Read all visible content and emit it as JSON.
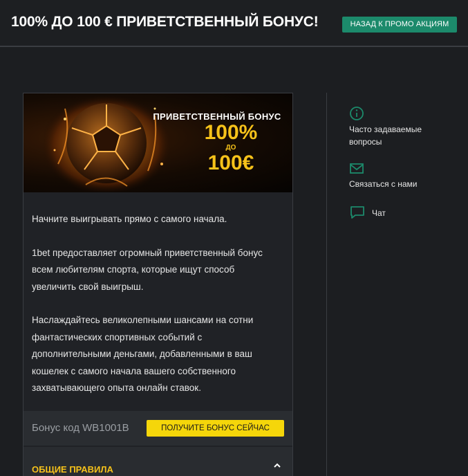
{
  "header": {
    "title": "100% ДО 100 € ПРИВЕТСТВЕННЫЙ БОНУС!",
    "back_button": "НАЗАД К ПРОМО АКЦИЯМ"
  },
  "banner": {
    "line1": "ПРИВЕТСТВЕННЫЙ БОНУС",
    "percent": "100%",
    "do": "ДО",
    "amount": "100€"
  },
  "body": {
    "p1": "Начните выигрывать прямо с самого начала.",
    "p2": "1bet предоставляет огромный приветственный бонус всем любителям спорта, которые ищут способ увеличить свой выигрыш.",
    "p3": "Наслаждайтесь великолепными шансами на сотни фантастических спортивных событий с дополнительными деньгами, добавленными в ваш кошелек с самого начала вашего собственного захватывающего опыта онлайн ставок."
  },
  "bonus": {
    "code_label": "Бонус код WB1001B",
    "get_button": "ПОЛУЧИТЕ БОНУС СЕЙЧАС"
  },
  "rules": {
    "title": "ОБЩИЕ ПРАВИЛА"
  },
  "sidebar": {
    "faq": "Часто задаваемые вопросы",
    "contact": "Связаться с нами",
    "chat": "Чат"
  },
  "colors": {
    "accent_green": "#1c8a6b",
    "accent_yellow": "#f5d60a",
    "gold_text": "#f6c21a"
  }
}
